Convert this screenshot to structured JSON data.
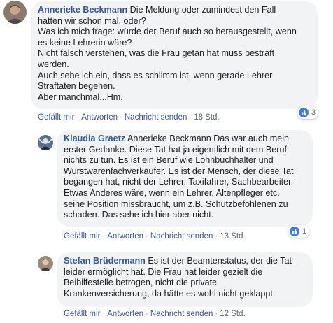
{
  "comments": [
    {
      "author": "Annerieke Beckmann",
      "lines": [
        "Die Meldung oder zumindest den Fall",
        "hatten wir schon mal, oder?",
        "Was ich mich frage: würde der Beruf auch so herausgestellt, wenn",
        "es keine Lehrerin wäre?",
        "Nicht falsch verstehen, was die Frau getan hat muss bestraft",
        "werden.",
        "Auch sehe ich ein, dass es schlimm ist, wenn gerade Lehrer",
        "Straftaten begehen.",
        "Aber manchmal...Hm."
      ],
      "actions": {
        "like": "Gefällt mir",
        "reply": "Antworten",
        "message": "Nachricht senden",
        "time": "18 Std."
      },
      "reactions_count": "3"
    },
    {
      "author": "Klaudia Graetz",
      "lines": [
        "Annerieke Beckmann Das war auch mein",
        "erster Gedanke. Diese Tat hat ja eigentlich mit dem Beruf",
        "nichts zu tun. Es ist ein Beruf wie Lohnbuchhalter und",
        "Wurstwarenfachverkäufer. Es ist der Mensch, der diese Tat",
        "begangen hat, nicht der Lehrer, Taxifahrer, Sachbearbeiter.",
        "Etwas Anderes wäre, wenn ein Lehrer, Altenpfleger etc.",
        "seine Position missbraucht, um z.B. Schutzbefohlenen zu",
        "schaden. Das sehe ich hier aber nicht."
      ],
      "actions": {
        "like": "Gefällt mir",
        "reply": "Antworten",
        "message": "Nachricht senden",
        "time": "13 Std."
      },
      "reactions_count": "1"
    },
    {
      "author": "Stefan Brüdermann",
      "lines": [
        "Es ist der Beamtenstatus, der die Tat",
        "leider ermöglicht hat. Die Frau hat leider gezielt die",
        "Beihilfestelle betrogen, nicht die private",
        "Krankenversicherung, da hätte es wohl nicht geklappt."
      ],
      "actions": {
        "like": "Gefällt mir",
        "reply": "Antworten",
        "message": "Nachricht senden",
        "time": "12 Std."
      }
    }
  ],
  "colors": {
    "link": "#385898",
    "bubble": "#f2f3f5",
    "like": "#3b79e6",
    "meta": "#606770"
  },
  "icons": [
    "avatar-photo",
    "thumbs-up-icon"
  ]
}
